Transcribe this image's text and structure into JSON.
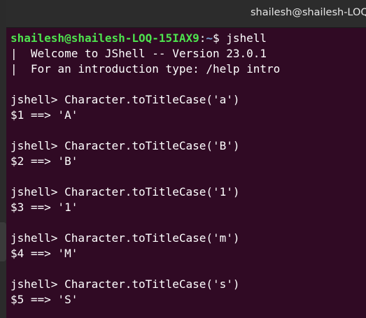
{
  "window": {
    "title": "shailesh@shailesh-LOQ-1"
  },
  "prompt": {
    "user_host": "shailesh@shailesh-LOQ-15IAX9",
    "colon": ":",
    "path": "~",
    "symbol": "$ ",
    "command": "jshell"
  },
  "banner": {
    "line1": "|  Welcome to JShell -- Version 23.0.1",
    "line2": "|  For an introduction type: /help intro"
  },
  "session": [
    {
      "input": "jshell> Character.toTitleCase('a')",
      "output": "$1 ==> 'A'"
    },
    {
      "input": "jshell> Character.toTitleCase('B')",
      "output": "$2 ==> 'B'"
    },
    {
      "input": "jshell> Character.toTitleCase('1')",
      "output": "$3 ==> '1'"
    },
    {
      "input": "jshell> Character.toTitleCase('m')",
      "output": "$4 ==> 'M'"
    },
    {
      "input": "jshell> Character.toTitleCase('s')",
      "output": "$5 ==> 'S'"
    }
  ],
  "colors": {
    "terminal_bg": "#300a24",
    "prompt_user": "#4ee24e",
    "prompt_path": "#729fcf",
    "text": "#ffffff"
  }
}
